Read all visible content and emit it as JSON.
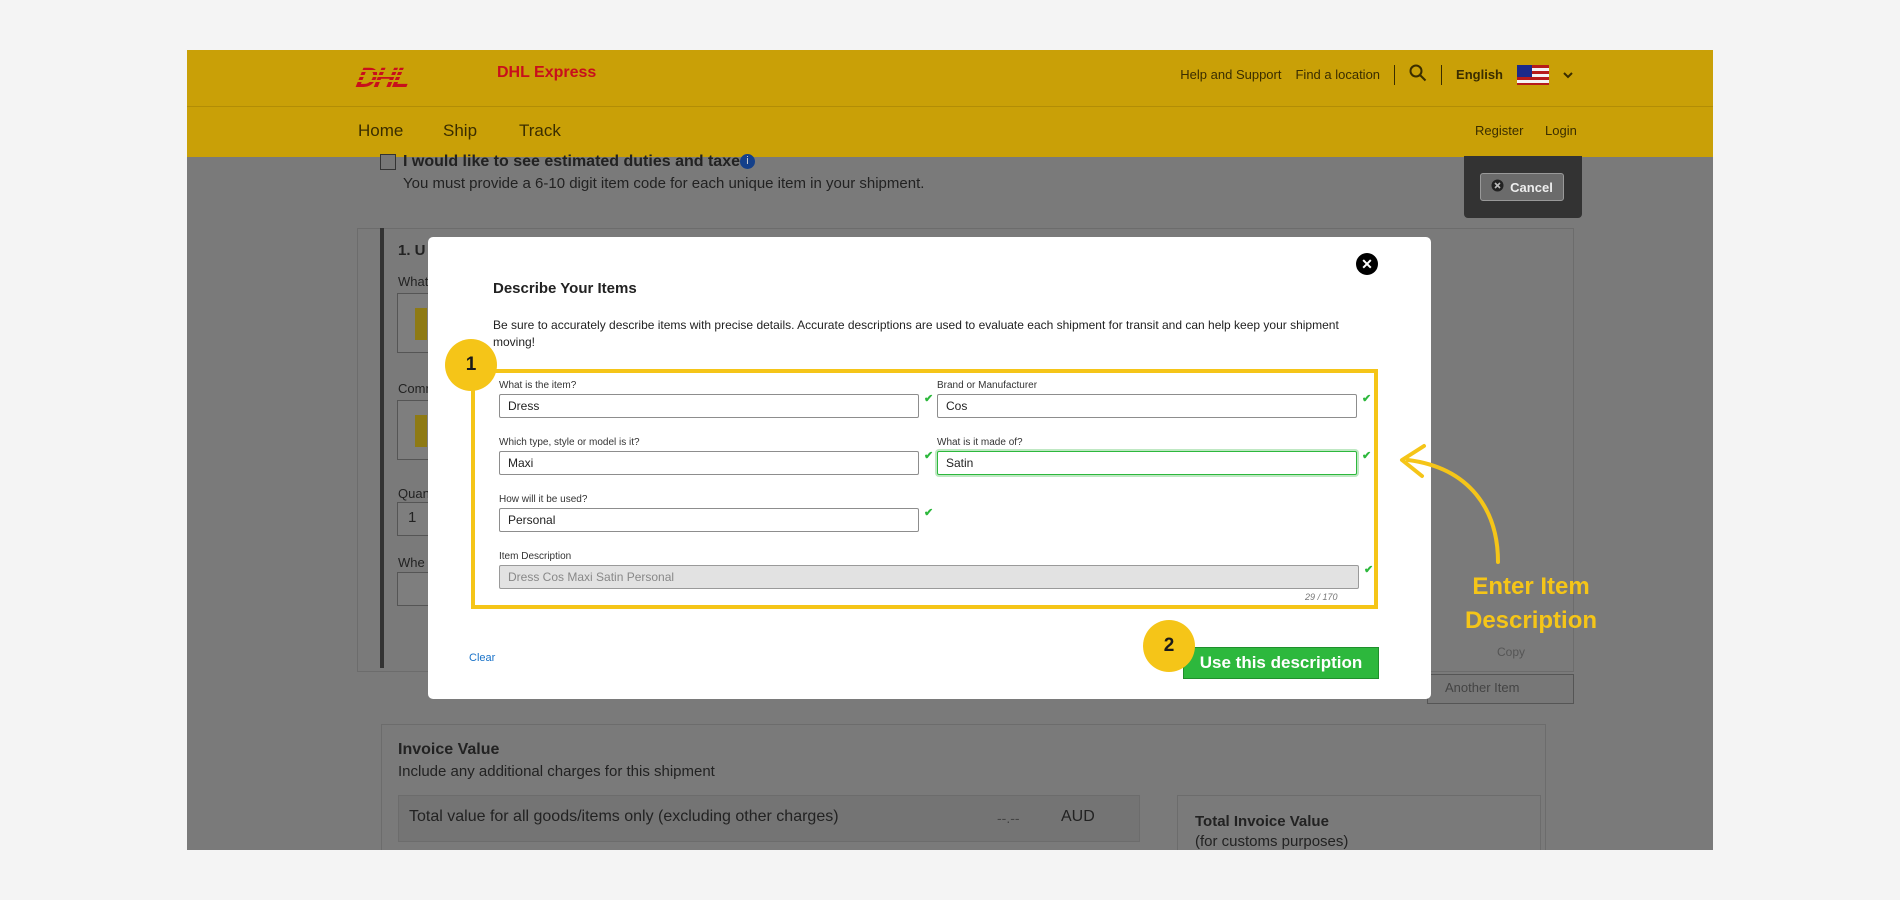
{
  "header": {
    "logo_text": "DHL",
    "brand": "DHL Express",
    "help": "Help and Support",
    "find": "Find a location",
    "language": "English",
    "nav": [
      "Home",
      "Ship",
      "Track"
    ],
    "register": "Register",
    "login": "Login"
  },
  "background": {
    "duties_check_label": "I would like to see estimated duties and taxes",
    "duties_note": "You must provide a 6-10 digit item code for each unique item in your shipment.",
    "cancel_label": "Cancel",
    "section_prefix": "1. U",
    "what_prefix": "What",
    "comm_prefix": "Comm",
    "qty_prefix": "Quan",
    "qty_value": "1",
    "where_prefix": "Whe",
    "copy_label": "Copy",
    "another_item": "Another Item",
    "invoice_title": "Invoice Value",
    "invoice_sub": "Include any additional charges for this shipment",
    "total_goods_label": "Total value for all goods/items only (excluding other charges)",
    "total_goods_value": "--.--",
    "currency": "AUD",
    "total_invoice_title": "Total Invoice Value",
    "total_invoice_sub": "(for customs purposes)"
  },
  "modal": {
    "title": "Describe Your Items",
    "description": "Be sure to accurately describe items with precise details. Accurate descriptions are used to evaluate each shipment for transit and can help keep your shipment moving!",
    "fields": {
      "item": {
        "label": "What is the item?",
        "value": "Dress"
      },
      "brand": {
        "label": "Brand or Manufacturer",
        "value": "Cos"
      },
      "type": {
        "label": "Which type, style or model is it?",
        "value": "Maxi"
      },
      "material": {
        "label": "What is it made of?",
        "value": "Satin"
      },
      "use": {
        "label": "How will it be used?",
        "value": "Personal"
      },
      "item_description": {
        "label": "Item Description",
        "value": "Dress Cos Maxi Satin Personal"
      }
    },
    "char_counter": "29 / 170",
    "clear_label": "Clear",
    "use_button": "Use this description"
  },
  "annotations": {
    "step1": "1",
    "step2": "2",
    "callout_line1": "Enter Item",
    "callout_line2": "Description",
    "accent_color": "#f5c518"
  }
}
